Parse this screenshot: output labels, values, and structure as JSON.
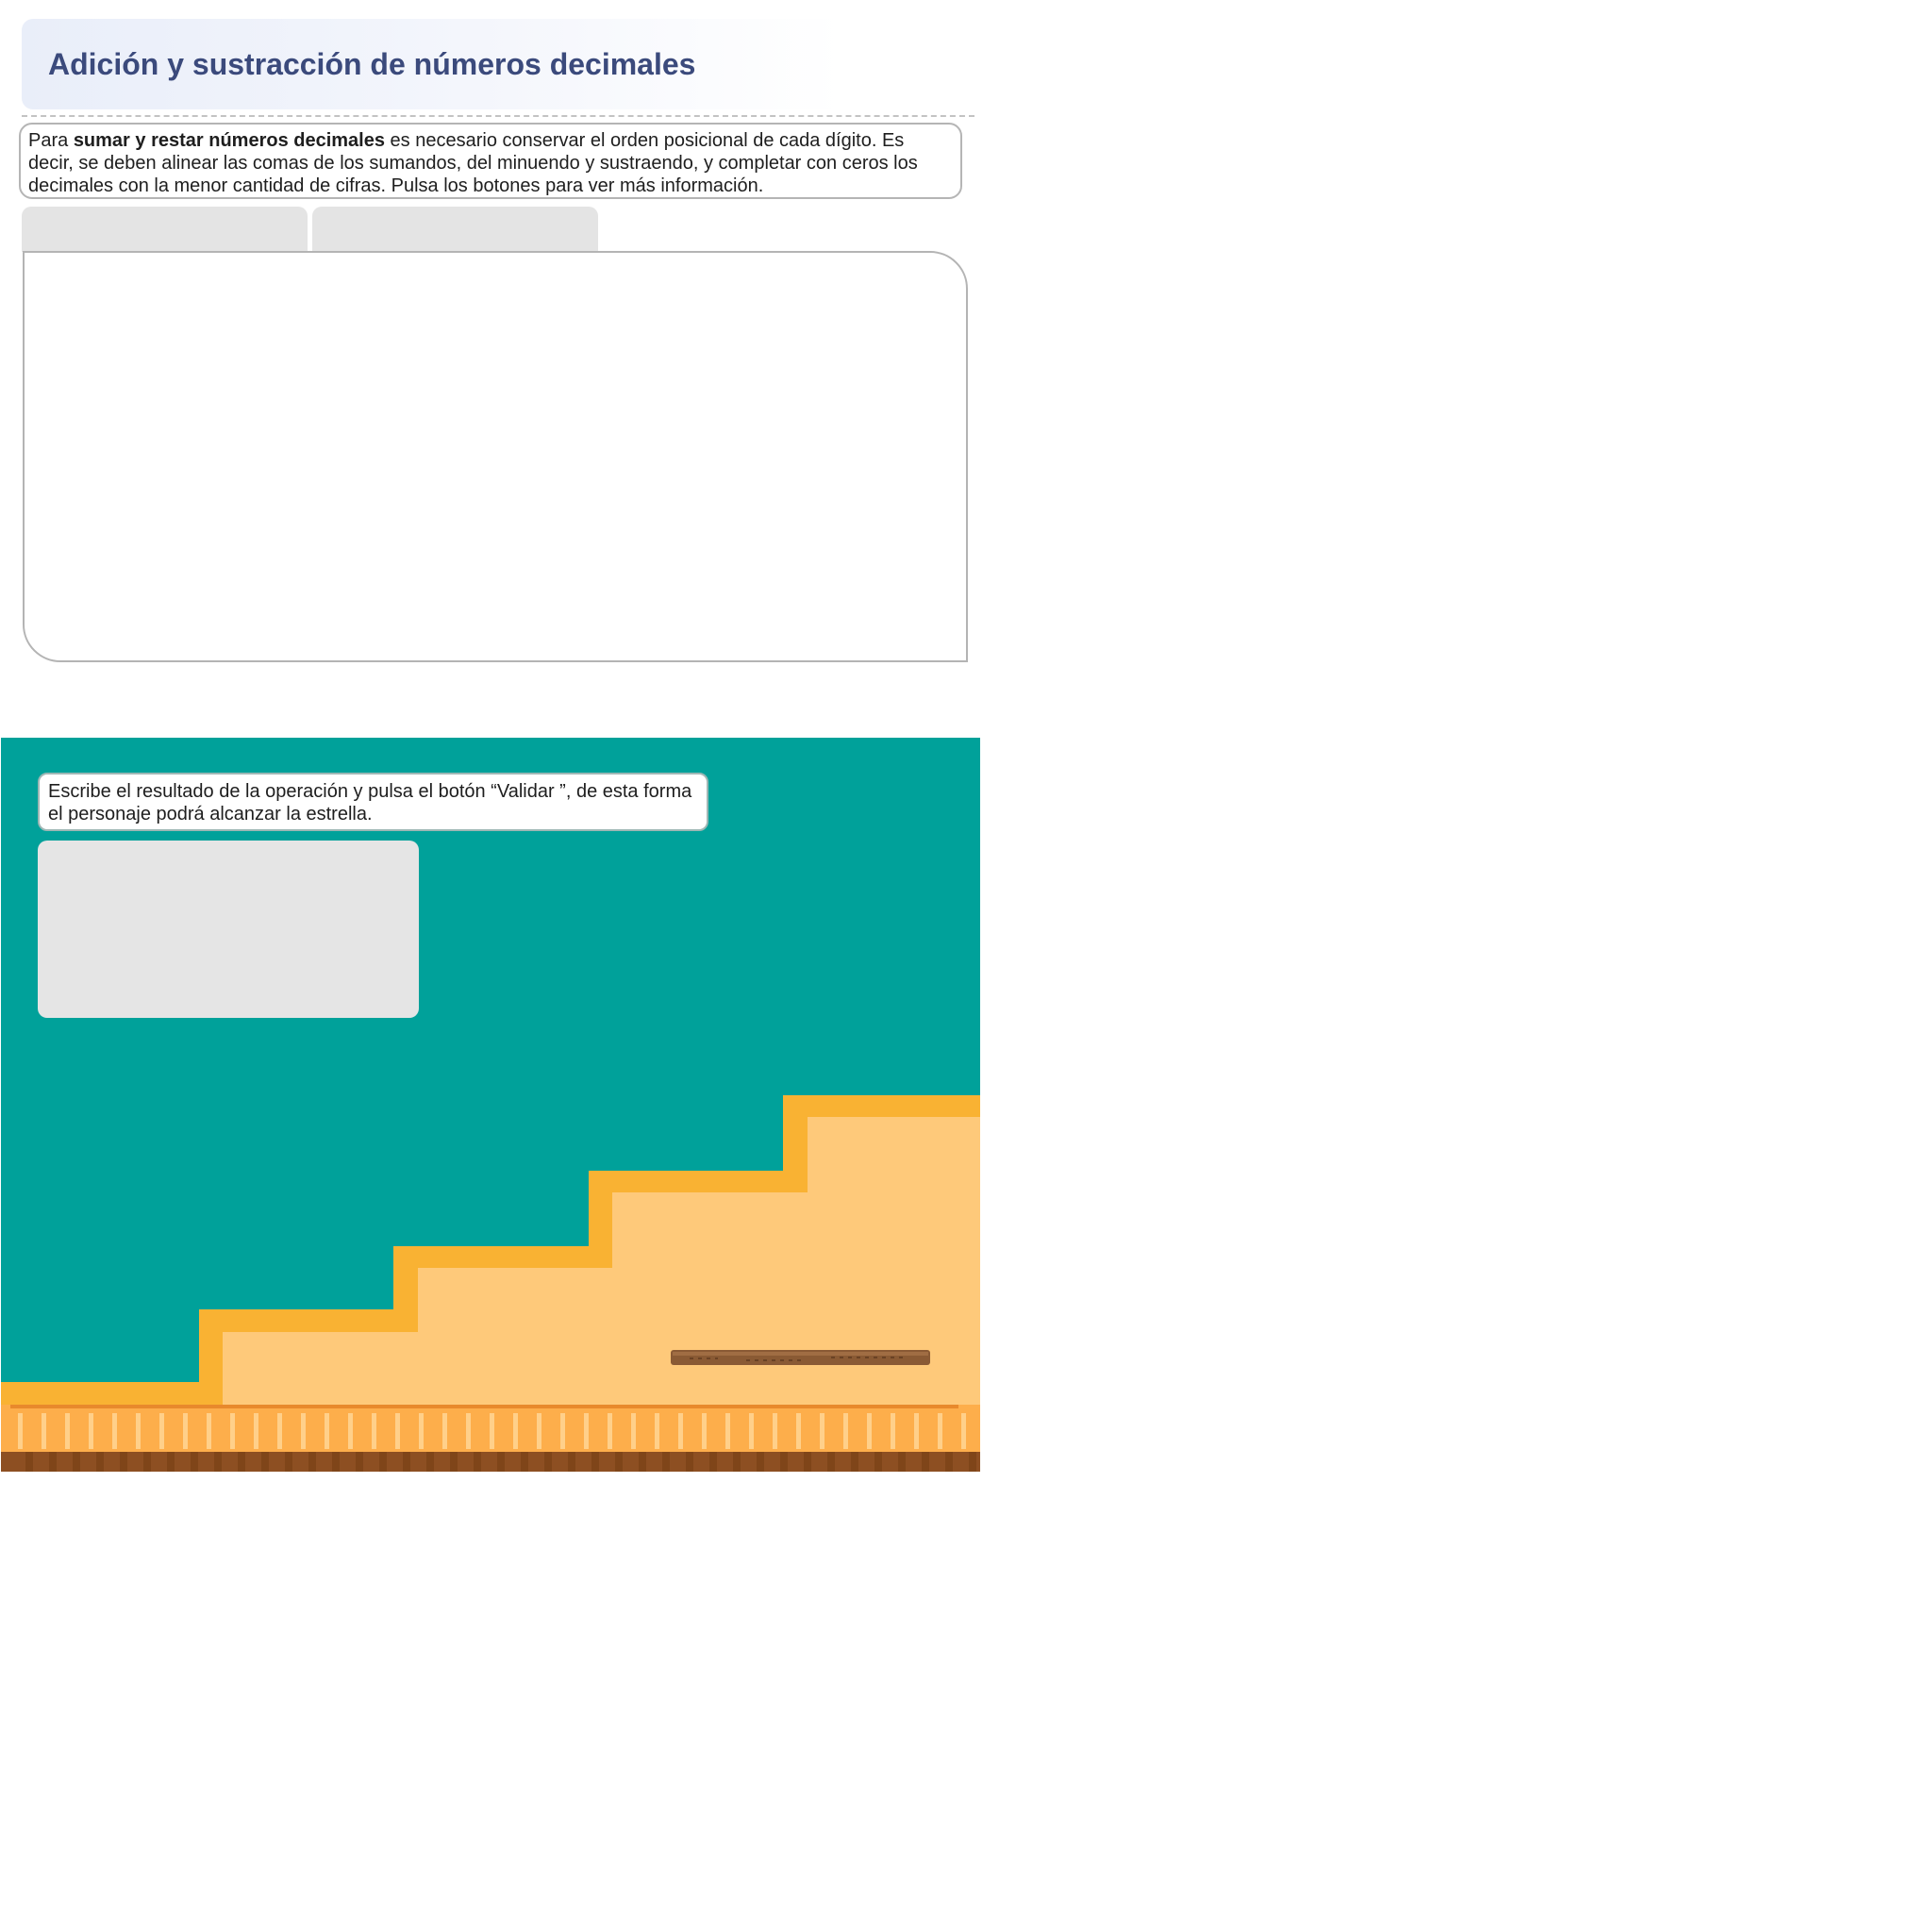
{
  "header": {
    "title": "Adición y sustracción de números decimales"
  },
  "intro": {
    "prefix": "Para ",
    "bold": "sumar y restar números decimales",
    "rest": " es necesario conservar el orden posicional de cada dígito. Es decir, se deben alinear las comas de los sumandos, del minuendo y sustraendo, y completar con ceros los decimales con la menor cantidad de cifras. Pulsa los botones para ver más información."
  },
  "tabs": [
    {
      "label": ""
    },
    {
      "label": ""
    }
  ],
  "game": {
    "instruction": "Escribe el resultado de la operación y pulsa el botón “Validar ”, de esta forma el personaje podrá alcanzar la estrella.",
    "operation": ""
  },
  "colors": {
    "title": "#3b4a7c",
    "game_background": "#00a19a",
    "stairs_edge": "#f9b233",
    "stairs_fill": "#fec97a",
    "floor": "#fdae4b",
    "floor_base": "#8d4f22",
    "plank": "#8a5a34"
  }
}
